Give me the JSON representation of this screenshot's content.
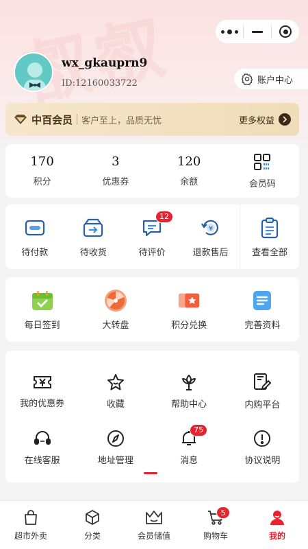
{
  "header": {
    "user": {
      "name": "wx_gkauprn9",
      "id": "ID:12160033722"
    },
    "account_center": "账户中心"
  },
  "vip": {
    "title": "中百会员",
    "slogan": "客户至上，品质无忧",
    "more": "更多权益"
  },
  "stats": [
    {
      "value": "170",
      "label": "积分"
    },
    {
      "value": "3",
      "label": "优惠券"
    },
    {
      "value": "120",
      "label": "余额"
    },
    {
      "value": "",
      "label": "会员码",
      "icon": "qr-code-icon"
    }
  ],
  "orders": [
    {
      "label": "待付款",
      "icon": "wallet-icon"
    },
    {
      "label": "待收货",
      "icon": "box-arrow-icon"
    },
    {
      "label": "待评价",
      "icon": "comment-icon",
      "badge": "12"
    },
    {
      "label": "退款售后",
      "icon": "refund-icon"
    },
    {
      "label": "查看全部",
      "icon": "clipboard-icon"
    }
  ],
  "tasks": [
    {
      "label": "每日签到",
      "icon": "calendar-check-icon"
    },
    {
      "label": "大转盘",
      "icon": "wheel-icon"
    },
    {
      "label": "积分兑换",
      "icon": "ticket-icon"
    },
    {
      "label": "完善资料",
      "icon": "document-icon"
    }
  ],
  "services": [
    [
      {
        "label": "我的优惠券",
        "icon": "coupon-icon"
      },
      {
        "label": "收藏",
        "icon": "star-icon"
      },
      {
        "label": "帮助中心",
        "icon": "flower-icon"
      },
      {
        "label": "内购平台",
        "icon": "edit-book-icon"
      }
    ],
    [
      {
        "label": "在线客服",
        "icon": "headset-icon"
      },
      {
        "label": "地址管理",
        "icon": "compass-icon"
      },
      {
        "label": "消息",
        "icon": "bell-icon",
        "badge": "75"
      },
      {
        "label": "协议说明",
        "icon": "info-icon"
      }
    ]
  ],
  "tabbar": [
    {
      "label": "超市外卖",
      "icon": "shopping-bag-icon"
    },
    {
      "label": "分类",
      "icon": "cube-icon"
    },
    {
      "label": "会员储值",
      "icon": "crown-icon"
    },
    {
      "label": "购物车",
      "icon": "cart-icon",
      "badge": "5"
    },
    {
      "label": "我的",
      "icon": "profile-icon",
      "active": true
    }
  ],
  "colors": {
    "accent": "#e6232f",
    "vip_bg": "#f1dfbe",
    "page_bg": "#f4f4f4"
  }
}
